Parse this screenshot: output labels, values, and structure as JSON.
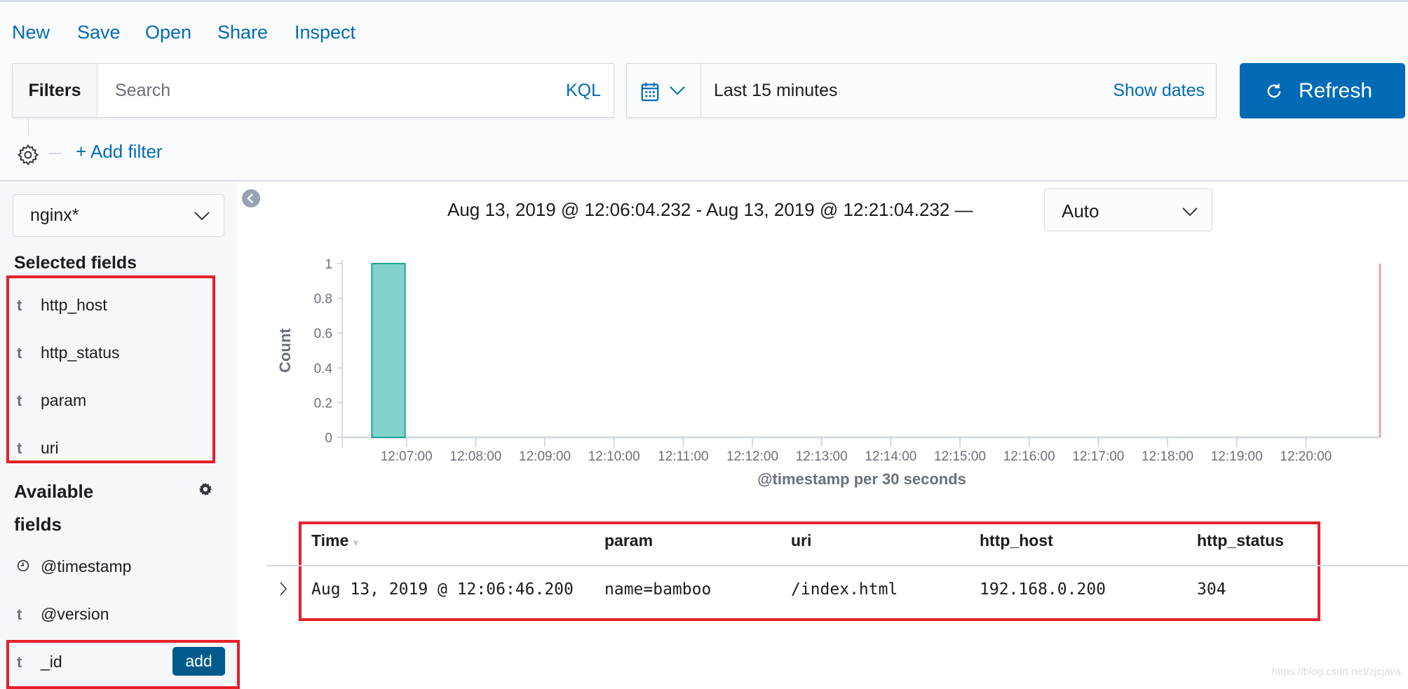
{
  "menu": [
    "New",
    "Save",
    "Open",
    "Share",
    "Inspect"
  ],
  "query": {
    "filters_label": "Filters",
    "placeholder": "Search",
    "language": "KQL",
    "add_filter": "+ Add filter"
  },
  "time": {
    "range": "Last 15 minutes",
    "show_dates": "Show dates",
    "refresh": "Refresh"
  },
  "sidebar": {
    "index_pattern": "nginx*",
    "selected_title": "Selected fields",
    "selected": [
      {
        "type": "t",
        "name": "http_host"
      },
      {
        "type": "t",
        "name": "http_status"
      },
      {
        "type": "t",
        "name": "param"
      },
      {
        "type": "t",
        "name": "uri"
      }
    ],
    "available_title_1": "Available",
    "available_title_2": "fields",
    "available": [
      {
        "type": "clock",
        "name": "@timestamp"
      },
      {
        "type": "t",
        "name": "@version"
      },
      {
        "type": "t",
        "name": "_id"
      }
    ],
    "add_label": "add"
  },
  "histogram": {
    "range_text": "Aug 13, 2019 @ 12:06:04.232 - Aug 13, 2019 @ 12:21:04.232 —",
    "interval": "Auto"
  },
  "chart_data": {
    "type": "bar",
    "xlabel": "@timestamp per 30 seconds",
    "ylabel": "Count",
    "ylim": [
      0,
      1
    ],
    "yticks": [
      "0",
      "0.2",
      "0.4",
      "0.6",
      "0.8",
      "1"
    ],
    "xlim": [
      "12:06:04.232",
      "12:21:04.232"
    ],
    "xticks": [
      "12:07:00",
      "12:08:00",
      "12:09:00",
      "12:10:00",
      "12:11:00",
      "12:12:00",
      "12:13:00",
      "12:14:00",
      "12:15:00",
      "12:16:00",
      "12:17:00",
      "12:18:00",
      "12:19:00",
      "12:20:00"
    ],
    "bars": [
      {
        "x": "12:06:30",
        "value": 1
      }
    ],
    "bar_color": "#83d2cb",
    "now_line_color": "#e7a9a9"
  },
  "table": {
    "columns": [
      "Time",
      "param",
      "uri",
      "http_host",
      "http_status"
    ],
    "rows": [
      [
        "Aug 13, 2019 @ 12:06:46.200",
        "name=bamboo",
        "/index.html",
        "192.168.0.200",
        "304"
      ]
    ]
  },
  "watermark": "https://blog.csdn.net/zjcjava"
}
